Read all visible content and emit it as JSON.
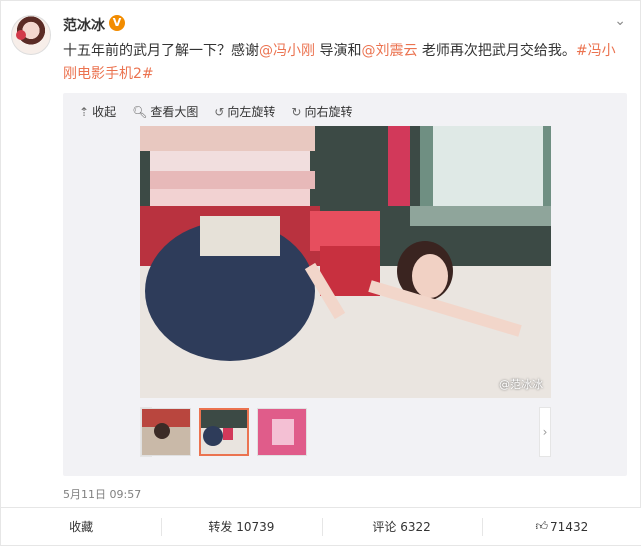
{
  "user": {
    "name": "范冰冰",
    "verified_badge": "V"
  },
  "post": {
    "text_parts": [
      {
        "t": "十五年前的武月了解一下？感谢",
        "cls": ""
      },
      {
        "t": "@冯小刚",
        "cls": "at"
      },
      {
        "t": " 导演和",
        "cls": ""
      },
      {
        "t": "@刘震云",
        "cls": "at"
      },
      {
        "t": " 老师再次把武月交给我。",
        "cls": ""
      },
      {
        "t": "#冯小刚电影手机2#",
        "cls": "tag"
      }
    ],
    "timestamp": "5月11日 09:57"
  },
  "media": {
    "toolbar": [
      {
        "icon": "collapse-icon",
        "glyph": "⇡",
        "label": "收起"
      },
      {
        "icon": "magnifier-icon",
        "glyph": "🔍︎",
        "label": "查看大图"
      },
      {
        "icon": "rotate-left-icon",
        "glyph": "↺",
        "label": "向左旋转"
      },
      {
        "icon": "rotate-right-icon",
        "glyph": "↻",
        "label": "向右旋转"
      }
    ],
    "watermark": "@范冰冰",
    "arrows": {
      "left": "‹",
      "right": "›"
    }
  },
  "actions": {
    "favorite": "收藏",
    "repost_label": "转发",
    "repost_count": "10739",
    "comment_label": "评论",
    "comment_count": "6322",
    "like_glyph": "👍︎",
    "like_count": "71432"
  },
  "colors": {
    "accent": "#eb7350",
    "badge": "#f28c00"
  }
}
